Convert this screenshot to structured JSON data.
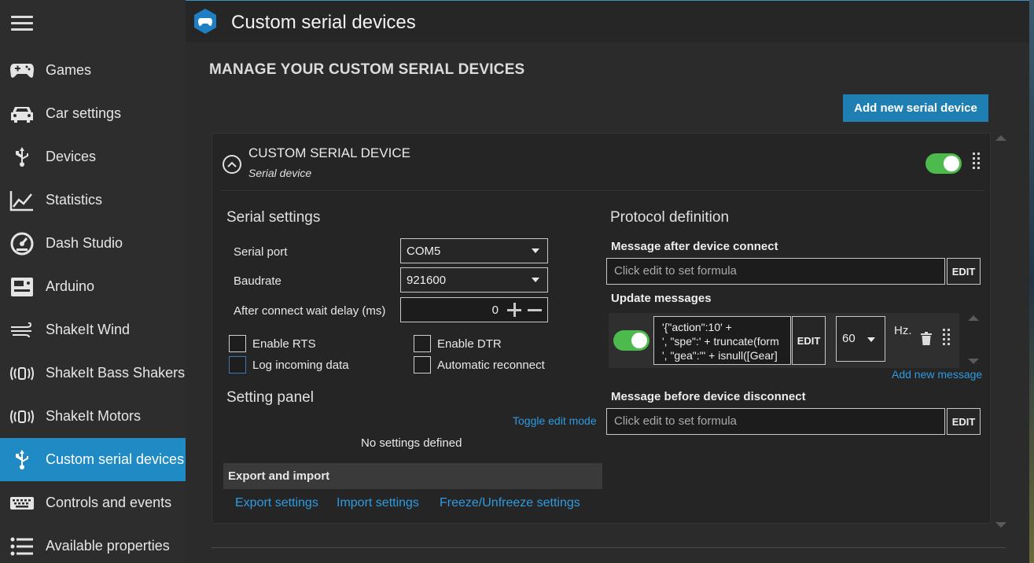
{
  "sidebar": {
    "items": [
      {
        "label": "Games",
        "icon": "gamepad-icon"
      },
      {
        "label": "Car settings",
        "icon": "car-icon"
      },
      {
        "label": "Devices",
        "icon": "usb-icon"
      },
      {
        "label": "Statistics",
        "icon": "chart-line-icon"
      },
      {
        "label": "Dash Studio",
        "icon": "gauge-icon"
      },
      {
        "label": "Arduino",
        "icon": "arduino-board-icon"
      },
      {
        "label": "ShakeIt Wind",
        "icon": "wind-icon"
      },
      {
        "label": "ShakeIt Bass Shakers",
        "icon": "vibration-icon"
      },
      {
        "label": "ShakeIt Motors",
        "icon": "vibration-icon"
      },
      {
        "label": "Custom serial devices",
        "icon": "usb-icon"
      },
      {
        "label": "Controls and events",
        "icon": "keyboard-icon"
      },
      {
        "label": "Available properties",
        "icon": "list-icon"
      }
    ],
    "active": "Custom serial devices"
  },
  "header": {
    "title": "Custom serial devices"
  },
  "main": {
    "section_title": "MANAGE YOUR CUSTOM SERIAL DEVICES",
    "add_button": "Add new serial device",
    "device": {
      "title": "CUSTOM SERIAL DEVICE",
      "subtitle": "Serial device",
      "enabled": true,
      "serial_settings": {
        "heading": "Serial settings",
        "serial_port_label": "Serial port",
        "serial_port_value": "COM5",
        "baudrate_label": "Baudrate",
        "baudrate_value": "921600",
        "wait_delay_label": "After connect wait delay (ms)",
        "wait_delay_value": "0",
        "checkboxes": {
          "enable_rts": "Enable RTS",
          "enable_dtr": "Enable DTR",
          "log_incoming": "Log incoming data",
          "auto_reconnect": "Automatic reconnect"
        }
      },
      "setting_panel": {
        "heading": "Setting panel",
        "toggle_edit": "Toggle edit mode",
        "empty_text": "No settings defined"
      },
      "export_import": {
        "heading": "Export and import",
        "export": "Export settings",
        "import": "Import settings",
        "freeze": "Freeze/Unfreeze settings"
      },
      "protocol": {
        "heading": "Protocol definition",
        "after_connect_label": "Message after device connect",
        "after_connect_placeholder": "Click edit to set formula",
        "edit_label": "EDIT",
        "update_label": "Update messages",
        "update_message": {
          "enabled": true,
          "code": "'{\"action\":10' +\n', \"spe\":' + truncate(form\n', \"gea\":\"' + isnull([Gear]",
          "frequency": "60",
          "unit": "Hz."
        },
        "add_message": "Add new message",
        "before_disconnect_label": "Message before device disconnect",
        "before_disconnect_placeholder": "Click edit to set formula"
      }
    }
  },
  "colors": {
    "accent": "#1f8ac4",
    "toggle_on": "#4cba4c",
    "link": "#2e9be0"
  }
}
